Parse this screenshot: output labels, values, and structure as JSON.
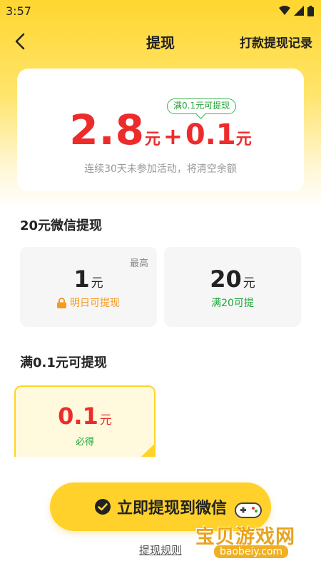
{
  "status_bar": {
    "time": "3:57"
  },
  "nav": {
    "title": "提现",
    "right_link": "打款提现记录"
  },
  "balance": {
    "tag": "满0.1元可提现",
    "main_amount": "2.8",
    "main_unit": "元",
    "plus": "+",
    "bonus_amount": "0.1",
    "bonus_unit": "元",
    "notice": "连续30天未参加活动，将清空余额"
  },
  "wechat_section": {
    "title": "20元微信提现",
    "options": [
      {
        "tag": "最高",
        "amount": "1",
        "unit": "元",
        "sub": "明日可提现"
      },
      {
        "amount": "20",
        "unit": "元",
        "sub": "满20可提"
      }
    ]
  },
  "small_section": {
    "title": "满0.1元可提现",
    "options": [
      {
        "amount": "0.1",
        "unit": "元",
        "sub": "必得"
      }
    ]
  },
  "cta": {
    "label": "立即提现到微信"
  },
  "rules_link": "提现规则",
  "watermark": {
    "text": "宝贝游戏网",
    "url": "baobeiy.com"
  },
  "colors": {
    "accent_yellow": "#ffd12a",
    "amount_red": "#ee2b2b",
    "green": "#1fa83a",
    "orange": "#f59a23"
  }
}
